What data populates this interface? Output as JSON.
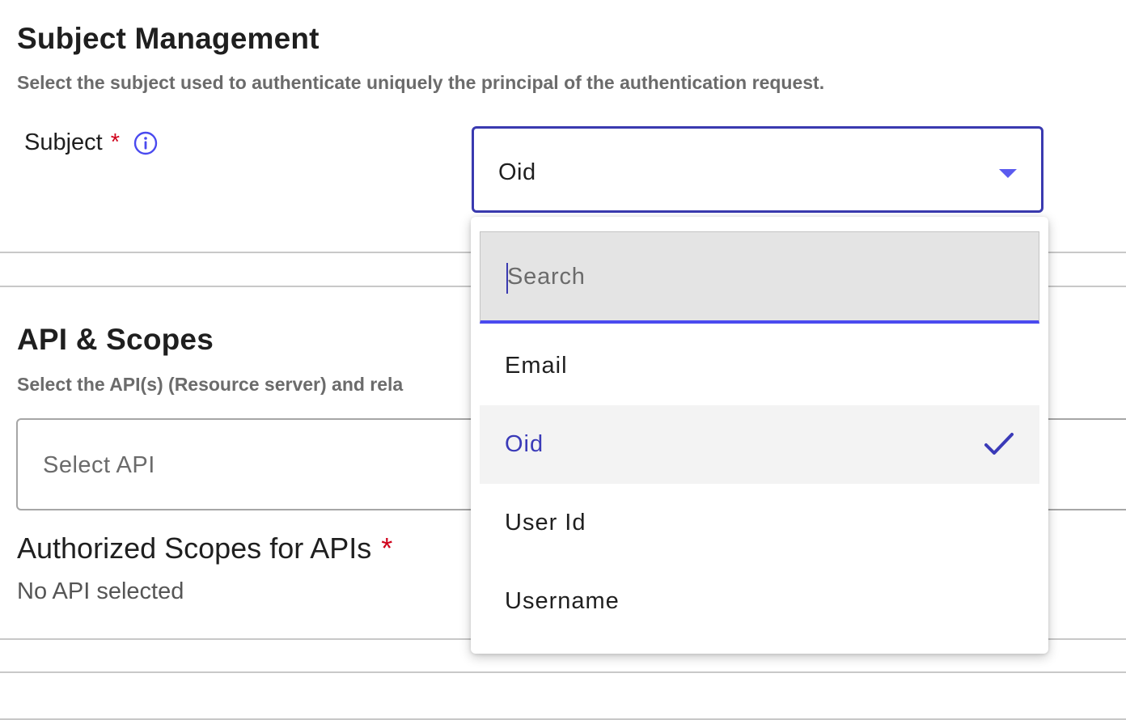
{
  "subject_section": {
    "title": "Subject Management",
    "description": "Select the subject used to authenticate uniquely the principal of the authentication request.",
    "field_label": "Subject",
    "required_mark": "*",
    "info_icon": "info-icon",
    "selected_value": "Oid"
  },
  "api_section": {
    "title": "API & Scopes",
    "description": "Select the API(s) (Resource server) and rela",
    "api_placeholder": "Select API",
    "scopes_title": "Authorized Scopes for APIs",
    "scopes_required_mark": "*",
    "no_api_text": "No API selected"
  },
  "dropdown": {
    "search_placeholder": "Search",
    "options": [
      {
        "label": "Email",
        "selected": false
      },
      {
        "label": "Oid",
        "selected": true
      },
      {
        "label": "User Id",
        "selected": false
      },
      {
        "label": "Username",
        "selected": false
      }
    ],
    "selected_icon": "check-icon"
  },
  "colors": {
    "accent": "#3a3ab0",
    "accent_light": "#5b5bef",
    "required": "#d0021b",
    "muted_text": "#6b6b6b"
  }
}
